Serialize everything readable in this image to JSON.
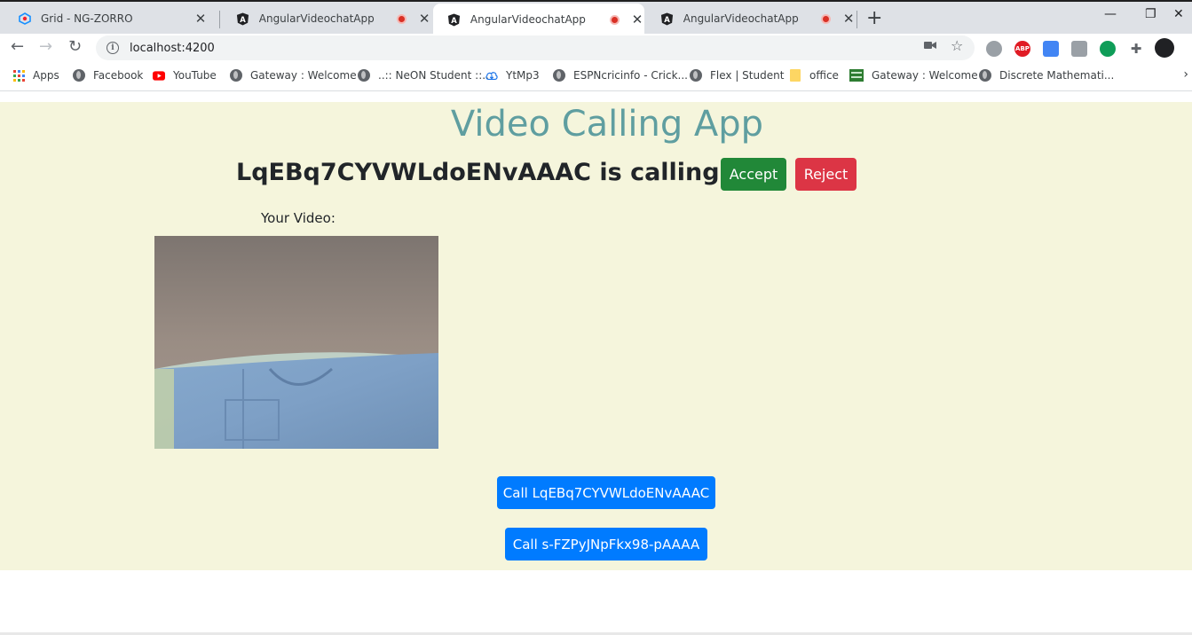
{
  "browser": {
    "tabs": [
      {
        "title": "Grid - NG-ZORRO",
        "recording": false,
        "active": false
      },
      {
        "title": "AngularVideochatApp",
        "recording": true,
        "active": false
      },
      {
        "title": "AngularVideochatApp",
        "recording": true,
        "active": true
      },
      {
        "title": "AngularVideochatApp",
        "recording": true,
        "active": false
      }
    ],
    "url": "localhost:4200",
    "bookmarks": [
      {
        "label": "Apps",
        "icon": "apps-grid-icon"
      },
      {
        "label": "Facebook",
        "icon": "globe-icon"
      },
      {
        "label": "YouTube",
        "icon": "youtube-icon"
      },
      {
        "label": "Gateway : Welcome",
        "icon": "globe-icon"
      },
      {
        "label": "..:: NeON Student ::..",
        "icon": "globe-icon"
      },
      {
        "label": "YtMp3",
        "icon": "cloud-download-icon"
      },
      {
        "label": "ESPNcricinfo - Crick...",
        "icon": "globe-icon"
      },
      {
        "label": "Flex | Student",
        "icon": "globe-icon"
      },
      {
        "label": "office",
        "icon": "folder-icon"
      },
      {
        "label": "Gateway : Welcome",
        "icon": "globe-icon"
      },
      {
        "label": "Discrete Mathemati...",
        "icon": "globe-icon"
      }
    ]
  },
  "app": {
    "title": "Video Calling App",
    "incoming_call_text": "LqEBq7CYVWLdoENvAAAC is calling you",
    "accept_label": "Accept",
    "reject_label": "Reject",
    "your_video_label": "Your Video:",
    "call_buttons": [
      "Call LqEBq7CYVWLdoENvAAAC",
      "Call s-FZPyJNpFkx98-pAAAA"
    ]
  },
  "colors": {
    "page_bg": "#f5f5dc",
    "title": "#5f9ea0",
    "accept": "#218838",
    "reject": "#dc3545",
    "call": "#007bff"
  }
}
